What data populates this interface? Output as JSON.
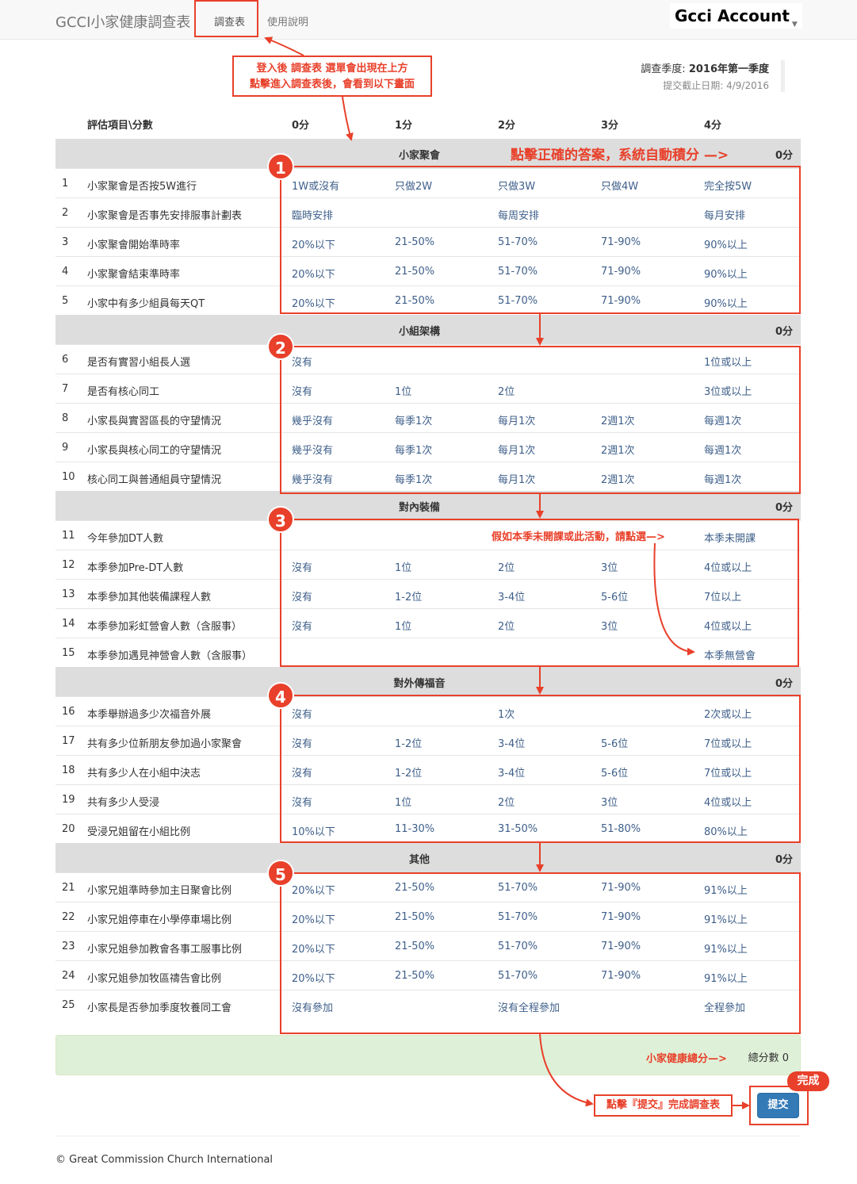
{
  "nav": {
    "brand": "GCCI小家健康調查表",
    "survey_tab": "調查表",
    "help_tab": "使用說明",
    "account": "Gcci Account"
  },
  "quarter": {
    "label": "調查季度: ",
    "value": "2016年第一季度",
    "deadline": "提交截止日期: 4/9/2016"
  },
  "table_header": {
    "item": "評估項目\\分數",
    "s0": "0分",
    "s1": "1分",
    "s2": "2分",
    "s3": "3分",
    "s4": "4分"
  },
  "categories": [
    {
      "name": "小家聚會",
      "score": "0分"
    },
    {
      "name": "小組架構",
      "score": "0分"
    },
    {
      "name": "對內裝備",
      "score": "0分"
    },
    {
      "name": "對外傳福音",
      "score": "0分"
    },
    {
      "name": "其他",
      "score": "0分"
    }
  ],
  "rows": [
    {
      "num": "1",
      "item": "小家聚會是否按5W進行",
      "o0": "1W或沒有",
      "o1": "只做2W",
      "o2": "只做3W",
      "o3": "只做4W",
      "o4": "完全按5W"
    },
    {
      "num": "2",
      "item": "小家聚會是否事先安排服事計劃表",
      "o0": "臨時安排",
      "o1": "",
      "o2": "每周安排",
      "o3": "",
      "o4": "每月安排"
    },
    {
      "num": "3",
      "item": "小家聚會開始準時率",
      "o0": "20%以下",
      "o1": "21-50%",
      "o2": "51-70%",
      "o3": "71-90%",
      "o4": "90%以上"
    },
    {
      "num": "4",
      "item": "小家聚會結束準時率",
      "o0": "20%以下",
      "o1": "21-50%",
      "o2": "51-70%",
      "o3": "71-90%",
      "o4": "90%以上"
    },
    {
      "num": "5",
      "item": "小家中有多少組員每天QT",
      "o0": "20%以下",
      "o1": "21-50%",
      "o2": "51-70%",
      "o3": "71-90%",
      "o4": "90%以上"
    },
    {
      "num": "6",
      "item": "是否有實習小組長人選",
      "o0": "沒有",
      "o1": "",
      "o2": "",
      "o3": "",
      "o4": "1位或以上"
    },
    {
      "num": "7",
      "item": "是否有核心同工",
      "o0": "沒有",
      "o1": "1位",
      "o2": "2位",
      "o3": "",
      "o4": "3位或以上"
    },
    {
      "num": "8",
      "item": "小家長與實習區長的守望情況",
      "o0": "幾乎沒有",
      "o1": "每季1次",
      "o2": "每月1次",
      "o3": "2週1次",
      "o4": "每週1次"
    },
    {
      "num": "9",
      "item": "小家長與核心同工的守望情況",
      "o0": "幾乎沒有",
      "o1": "每季1次",
      "o2": "每月1次",
      "o3": "2週1次",
      "o4": "每週1次"
    },
    {
      "num": "10",
      "item": "核心同工與普通組員守望情況",
      "o0": "幾乎沒有",
      "o1": "每季1次",
      "o2": "每月1次",
      "o3": "2週1次",
      "o4": "每週1次"
    },
    {
      "num": "11",
      "item": "今年參加DT人數",
      "o0": "",
      "o1": "",
      "o2": "",
      "o3": "",
      "o4": "本季未開課"
    },
    {
      "num": "12",
      "item": "本季參加Pre-DT人數",
      "o0": "沒有",
      "o1": "1位",
      "o2": "2位",
      "o3": "3位",
      "o4": "4位或以上"
    },
    {
      "num": "13",
      "item": "本季參加其他裝備課程人數",
      "o0": "沒有",
      "o1": "1-2位",
      "o2": "3-4位",
      "o3": "5-6位",
      "o4": "7位以上"
    },
    {
      "num": "14",
      "item": "本季參加彩虹營會人數（含服事）",
      "o0": "沒有",
      "o1": "1位",
      "o2": "2位",
      "o3": "3位",
      "o4": "4位或以上"
    },
    {
      "num": "15",
      "item": "本季參加遇見神營會人數（含服事）",
      "o0": "",
      "o1": "",
      "o2": "",
      "o3": "",
      "o4": "本季無營會"
    },
    {
      "num": "16",
      "item": "本季舉辦過多少次福音外展",
      "o0": "沒有",
      "o1": "",
      "o2": "1次",
      "o3": "",
      "o4": "2次或以上"
    },
    {
      "num": "17",
      "item": "共有多少位新朋友參加過小家聚會",
      "o0": "沒有",
      "o1": "1-2位",
      "o2": "3-4位",
      "o3": "5-6位",
      "o4": "7位或以上"
    },
    {
      "num": "18",
      "item": "共有多少人在小組中決志",
      "o0": "沒有",
      "o1": "1-2位",
      "o2": "3-4位",
      "o3": "5-6位",
      "o4": "7位或以上"
    },
    {
      "num": "19",
      "item": "共有多少人受浸",
      "o0": "沒有",
      "o1": "1位",
      "o2": "2位",
      "o3": "3位",
      "o4": "4位或以上"
    },
    {
      "num": "20",
      "item": "受浸兄姐留在小組比例",
      "o0": "10%以下",
      "o1": "11-30%",
      "o2": "31-50%",
      "o3": "51-80%",
      "o4": "80%以上"
    },
    {
      "num": "21",
      "item": "小家兄姐準時參加主日聚會比例",
      "o0": "20%以下",
      "o1": "21-50%",
      "o2": "51-70%",
      "o3": "71-90%",
      "o4": "91%以上"
    },
    {
      "num": "22",
      "item": "小家兄姐停車在小學停車場比例",
      "o0": "20%以下",
      "o1": "21-50%",
      "o2": "51-70%",
      "o3": "71-90%",
      "o4": "91%以上"
    },
    {
      "num": "23",
      "item": "小家兄姐參加教會各事工服事比例",
      "o0": "20%以下",
      "o1": "21-50%",
      "o2": "51-70%",
      "o3": "71-90%",
      "o4": "91%以上"
    },
    {
      "num": "24",
      "item": "小家兄姐參加牧區禱告會比例",
      "o0": "20%以下",
      "o1": "21-50%",
      "o2": "51-70%",
      "o3": "71-90%",
      "o4": "91%以上"
    },
    {
      "num": "25",
      "item": "小家長是否參加季度牧養同工會",
      "o0": "沒有參加",
      "o1": "",
      "o2": "沒有全程參加",
      "o3": "",
      "o4": "全程參加"
    }
  ],
  "total": {
    "label": "總分數 0"
  },
  "submit_label": "提交",
  "footer": "© Great Commission Church International",
  "annotations": {
    "callout_line1": "登入後 調查表 選單會出現在上方",
    "callout_line2": "點擊進入調查表後，會看到以下畫面",
    "auto_score": "點擊正確的答案，系統自動積分 —>",
    "no_course": "假如本季未開課或此活動，請點選—>",
    "total_hint": "小家健康總分—>",
    "submit_hint": "點擊『提交』完成調查表",
    "complete": "完成",
    "badges": [
      "1",
      "2",
      "3",
      "4",
      "5"
    ]
  },
  "colors": {
    "annotation_red": "#e8402a",
    "option_blue": "#3e5f8a",
    "category_gray": "#dddddd",
    "total_green": "#dff0d8",
    "submit_blue": "#337ab7"
  }
}
